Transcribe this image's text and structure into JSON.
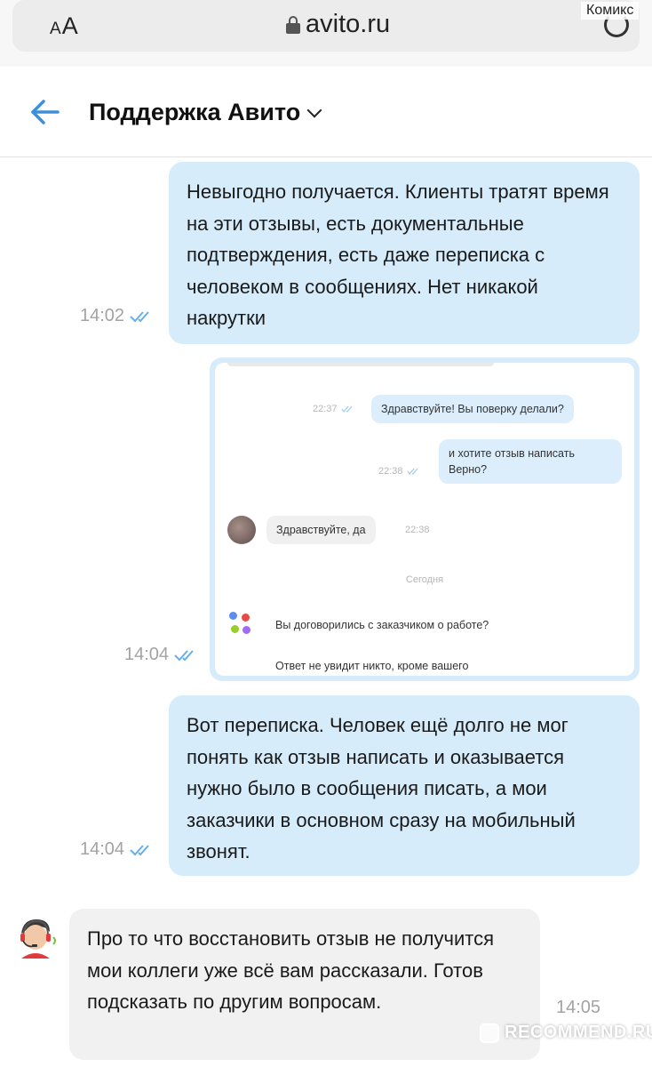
{
  "browser": {
    "aa_small": "A",
    "aa_large": "A",
    "url": "avito.ru",
    "watermark_top": "Комикс"
  },
  "header": {
    "title": "Поддержка Авито"
  },
  "messages": [
    {
      "text": "Невыгодно получается. Клиенты тратят время на эти отзывы, есть документальные подтверждения, есть даже переписка с человеком в сообщениях. Нет никакой накрутки",
      "time": "14:02"
    },
    {
      "time": "14:04",
      "screenshot": {
        "msg1": "Здравствуйте! Вы поверку делали?",
        "msg1_time": "22:37",
        "msg2": "и хотите отзыв написать Верно?",
        "msg2_time": "22:38",
        "reply": "Здравствуйте, да",
        "reply_time": "22:38",
        "today": "Сегодня",
        "question": "Вы договорились с заказчиком о работе?",
        "note": "Ответ не увидит никто, кроме вашего"
      }
    },
    {
      "text": "Вот переписка. Человек ещё долго не мог понять как отзыв написать и оказывается нужно было в сообщения писать, а мои заказчики в основном сразу на мобильный звонят.",
      "time": "14:04"
    },
    {
      "text": "Про то что восстановить отзыв не получится мои коллеги уже всё вам рассказали. Готов подсказать по другим вопросам.",
      "time": "14:05"
    }
  ],
  "watermark_bottom": "RECOMMEND.RU",
  "colors": {
    "outgoing_bubble": "#d6ecfb",
    "incoming_bubble": "#f1f1f1",
    "accent": "#3d8fd9",
    "timestamp": "#a3a3a3"
  }
}
